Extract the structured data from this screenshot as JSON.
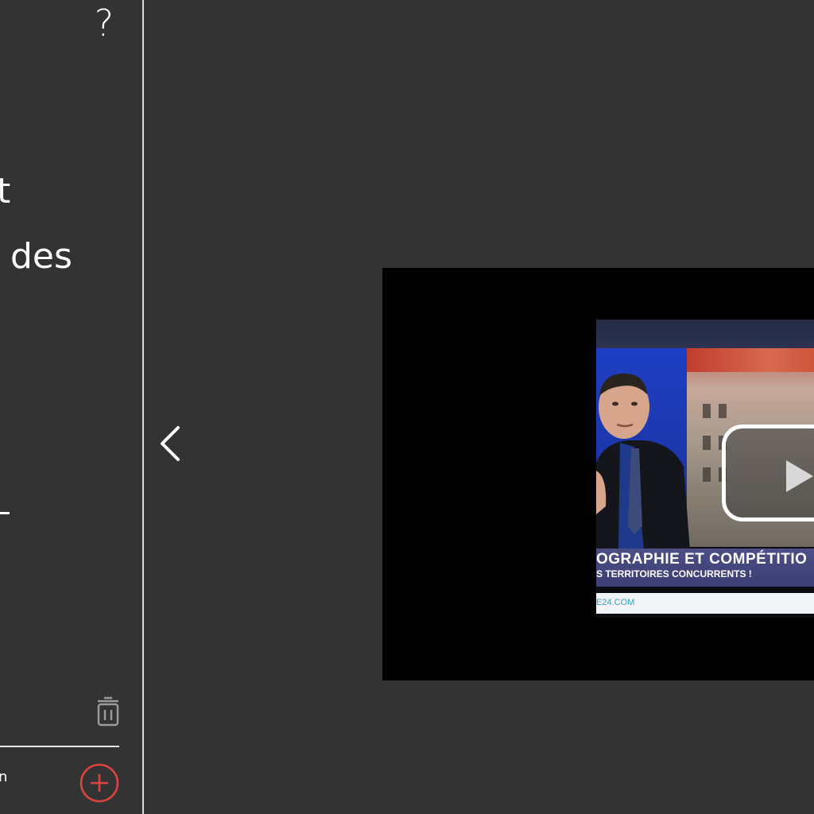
{
  "sidebar": {
    "help_icon": "question-mark-icon",
    "help_glyph": "?",
    "title_lines": [
      "t",
      "des"
    ],
    "bottom_text": "n",
    "trash_icon": "trash-icon",
    "add_icon": "plus-circle-icon"
  },
  "main": {
    "prev_icon": "chevron-left-icon",
    "video": {
      "banner_title": "OGRAPHIE ET COMPÉTITIO",
      "banner_subtitle": "S TERRITOIRES CONCURRENTS !",
      "url_fragment": "E24.COM",
      "play_icon": "play-icon"
    }
  },
  "colors": {
    "background": "#333333",
    "accent_red": "#e0443c",
    "divider": "#d9d9d9",
    "banner": "#3f437a"
  }
}
